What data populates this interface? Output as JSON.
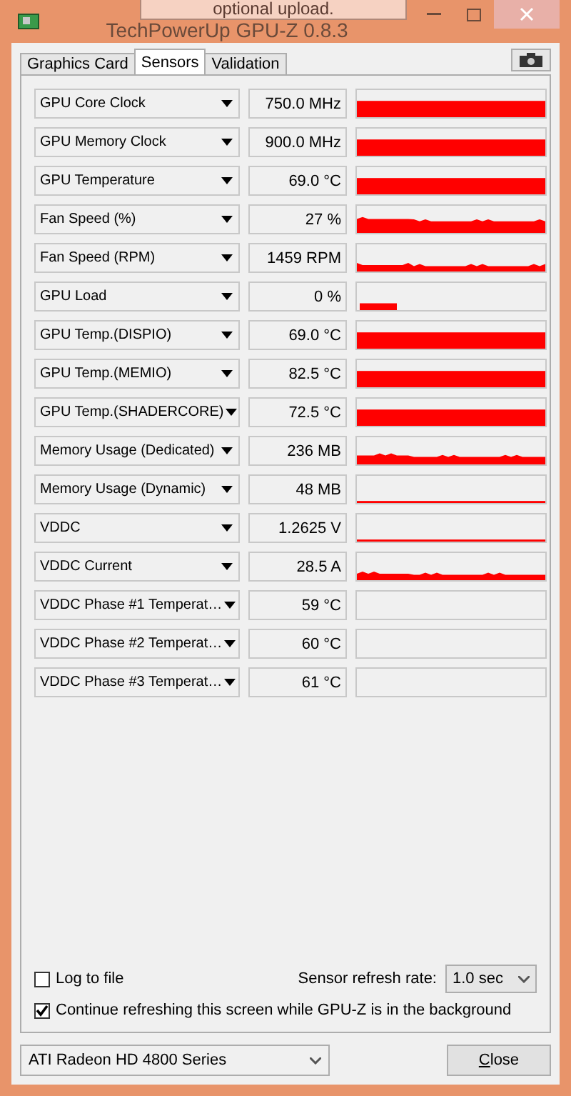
{
  "window": {
    "title": "TechPowerUp GPU-Z 0.8.3"
  },
  "tooltip": {
    "text": "optional upload."
  },
  "tabs": [
    {
      "label": "Graphics Card",
      "selected": false
    },
    {
      "label": "Sensors",
      "selected": true
    },
    {
      "label": "Validation",
      "selected": false
    }
  ],
  "sensors": [
    {
      "name": "GPU Core Clock",
      "value": "750.0 MHz",
      "kind": "high"
    },
    {
      "name": "GPU Memory Clock",
      "value": "900.0 MHz",
      "kind": "high"
    },
    {
      "name": "GPU Temperature",
      "value": "69.0 °C",
      "kind": "high"
    },
    {
      "name": "Fan Speed (%)",
      "value": "27 %",
      "kind": "noisy"
    },
    {
      "name": "Fan Speed (RPM)",
      "value": "1459 RPM",
      "kind": "noisy"
    },
    {
      "name": "GPU Load",
      "value": "0 %",
      "kind": "short"
    },
    {
      "name": "GPU Temp.(DISPIO)",
      "value": "69.0 °C",
      "kind": "high"
    },
    {
      "name": "GPU Temp.(MEMIO)",
      "value": "82.5 °C",
      "kind": "high"
    },
    {
      "name": "GPU Temp.(SHADERCORE)",
      "value": "72.5 °C",
      "kind": "high"
    },
    {
      "name": "Memory Usage (Dedicated)",
      "value": "236 MB",
      "kind": "noisy"
    },
    {
      "name": "Memory Usage (Dynamic)",
      "value": "48 MB",
      "kind": "low"
    },
    {
      "name": "VDDC",
      "value": "1.2625 V",
      "kind": "low"
    },
    {
      "name": "VDDC Current",
      "value": "28.5 A",
      "kind": "noisy"
    },
    {
      "name": "VDDC Phase #1 Temperat…",
      "value": "59 °C",
      "kind": "empty"
    },
    {
      "name": "VDDC Phase #2 Temperat…",
      "value": "60 °C",
      "kind": "empty"
    },
    {
      "name": "VDDC Phase #3 Temperat…",
      "value": "61 °C",
      "kind": "empty"
    }
  ],
  "log_to_file": {
    "label": "Log to file",
    "checked": false
  },
  "refresh_rate": {
    "label": "Sensor refresh rate:",
    "value": "1.0 sec"
  },
  "continue_refreshing": {
    "label": "Continue refreshing this screen while GPU-Z is in the background",
    "checked": true
  },
  "gpu_select": {
    "value": "ATI Radeon HD 4800 Series"
  },
  "close_button": {
    "label": "Close"
  }
}
